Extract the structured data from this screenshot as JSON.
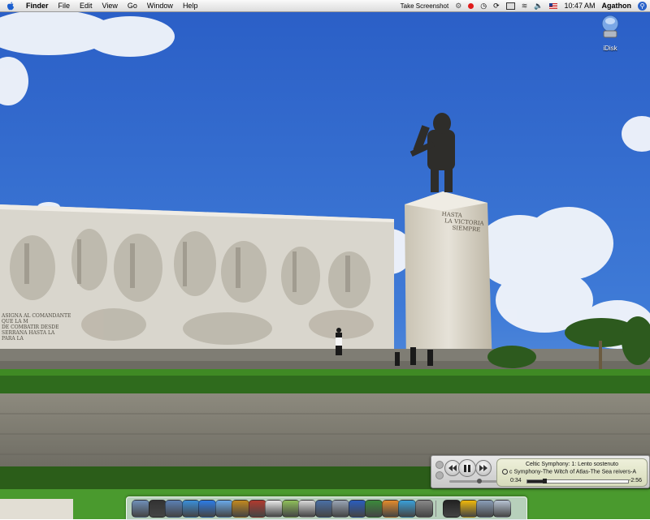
{
  "menubar": {
    "app_name": "Finder",
    "menus": [
      "File",
      "Edit",
      "View",
      "Go",
      "Window",
      "Help"
    ],
    "take_screenshot_label": "Take Screenshot",
    "time": "10:47 AM",
    "user": "Agathon"
  },
  "desktop": {
    "icons": [
      {
        "label": "iDisk",
        "icon": "idisk-icon"
      }
    ],
    "wallpaper_inscription": {
      "pedestal": [
        "HASTA",
        "LA VICTORIA",
        "SIEMPRE"
      ],
      "wall": [
        "ASIGNA AL COMANDANTE",
        "QUE LA M",
        "DE COMBATIR DESDE",
        "SERRANA HASTA LA",
        "PARA LA"
      ]
    }
  },
  "player": {
    "line1": "Celtic Symphony: 1: Lento sostenuto",
    "line2": "c Symphony-The Witch of Atlas-The Sea reivers-A",
    "elapsed": "0:34",
    "remaining": "-2:56",
    "progress": 0.17
  },
  "dock": {
    "items": [
      "finder-icon",
      "dashboard-icon",
      "mail-icon",
      "network-icon",
      "safari-icon",
      "ichat-icon",
      "amaze-icon",
      "dictionary-icon",
      "ical-icon",
      "itunes-icon",
      "notes-icon",
      "preview-icon",
      "screenshot-icon",
      "word-icon",
      "excel-icon",
      "pen-icon",
      "browser-icon",
      "apple-icon",
      "x11-icon",
      "star-icon",
      "image-icon",
      "trash-icon"
    ]
  },
  "colors": {
    "sky": "#3a74d6",
    "stone": "#d8d3c6",
    "hedge": "#2f6b1d",
    "grass": "#4a9a2e"
  }
}
